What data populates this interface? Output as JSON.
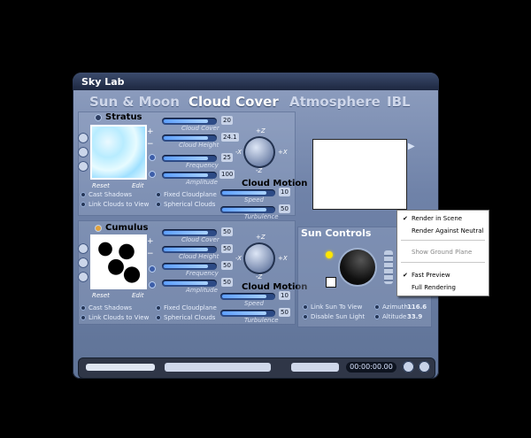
{
  "window": {
    "title": "Sky Lab"
  },
  "tabs": [
    {
      "label": "Sun & Moon"
    },
    {
      "label": "Cloud Cover"
    },
    {
      "label": "Atmosphere"
    },
    {
      "label": "IBL"
    }
  ],
  "stratus": {
    "title": "Stratus",
    "sliders": [
      {
        "label": "Cloud Cover",
        "value": "20"
      },
      {
        "label": "Cloud Height",
        "value": "24.1"
      },
      {
        "label": "Frequency",
        "value": "25"
      },
      {
        "label": "Amplitude",
        "value": "100"
      }
    ],
    "motion": {
      "title": "Cloud Motion",
      "speed_label": "Speed",
      "speed_value": "10",
      "turb_label": "Turbulence",
      "turb_value": "50"
    },
    "reset": "Reset",
    "edit": "Edit",
    "checks": [
      {
        "label": "Cast Shadows"
      },
      {
        "label": "Fixed Cloudplane"
      },
      {
        "label": "Link Clouds to View"
      },
      {
        "label": "Spherical Clouds"
      }
    ]
  },
  "cumulus": {
    "title": "Cumulus",
    "sliders": [
      {
        "label": "Cloud Cover",
        "value": "50"
      },
      {
        "label": "Cloud Height",
        "value": "50"
      },
      {
        "label": "Frequency",
        "value": "50"
      },
      {
        "label": "Amplitude",
        "value": "50"
      }
    ],
    "motion": {
      "title": "Cloud Motion",
      "speed_label": "Speed",
      "speed_value": "10",
      "turb_label": "Turbulence",
      "turb_value": "50"
    },
    "reset": "Reset",
    "edit": "Edit",
    "checks": [
      {
        "label": "Cast Shadows"
      },
      {
        "label": "Fixed Cloudplane"
      },
      {
        "label": "Link Clouds to View"
      },
      {
        "label": "Spherical Clouds"
      }
    ]
  },
  "axes": {
    "pz": "+Z",
    "mz": "-Z",
    "mx": "-X",
    "px": "+X"
  },
  "sun": {
    "title": "Sun Controls",
    "link": "Link Sun To View",
    "disable": "Disable Sun Light",
    "azimuth_label": "Azimuth :",
    "azimuth_value": "116.6",
    "altitude_label": "Altitude :",
    "altitude_value": "33.9"
  },
  "menu": {
    "items": [
      {
        "label": "Render in Scene",
        "checked": true
      },
      {
        "label": "Render Against Neutral",
        "checked": false
      },
      {
        "label": "Show Ground Plane",
        "checked": false,
        "disabled": true
      },
      {
        "label": "Fast Preview",
        "checked": true
      },
      {
        "label": "Full Rendering",
        "checked": false
      }
    ]
  },
  "timecode": "00:00:00.00"
}
